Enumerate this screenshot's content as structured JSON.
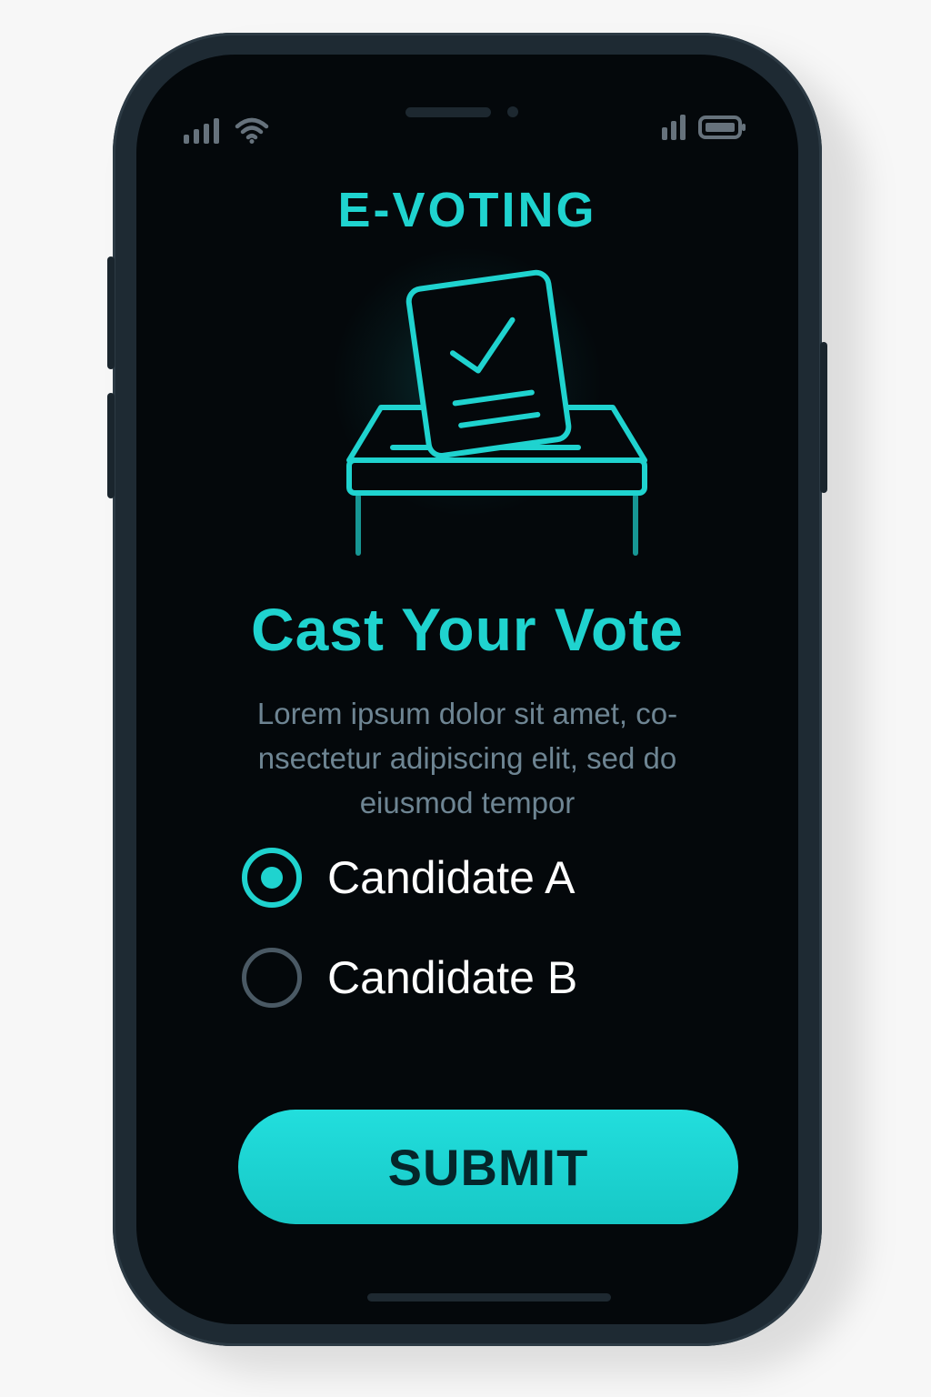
{
  "app": {
    "title": "E-VOTING"
  },
  "status_bar": {
    "left_icons": [
      "signal-icon",
      "wifi-icon"
    ],
    "right_icons": [
      "signal-icon",
      "battery-icon"
    ]
  },
  "illustration": {
    "icon": "ballot-box-icon"
  },
  "main": {
    "heading": "Cast Your Vote",
    "description": "Lorem ipsum dolor sit amet, co- nsectetur adipiscing elit, sed do eiusmod tempor"
  },
  "candidates": [
    {
      "label": "Candidate A",
      "selected": true
    },
    {
      "label": "Candidate B",
      "selected": false
    }
  ],
  "actions": {
    "submit_label": "SUBMIT"
  },
  "colors": {
    "accent": "#1fd3cf",
    "screen_background": "#04080b",
    "frame": "#1e2a33",
    "description_text": "#6e8593",
    "option_text": "#ffffff",
    "submit_text": "#05262a"
  }
}
